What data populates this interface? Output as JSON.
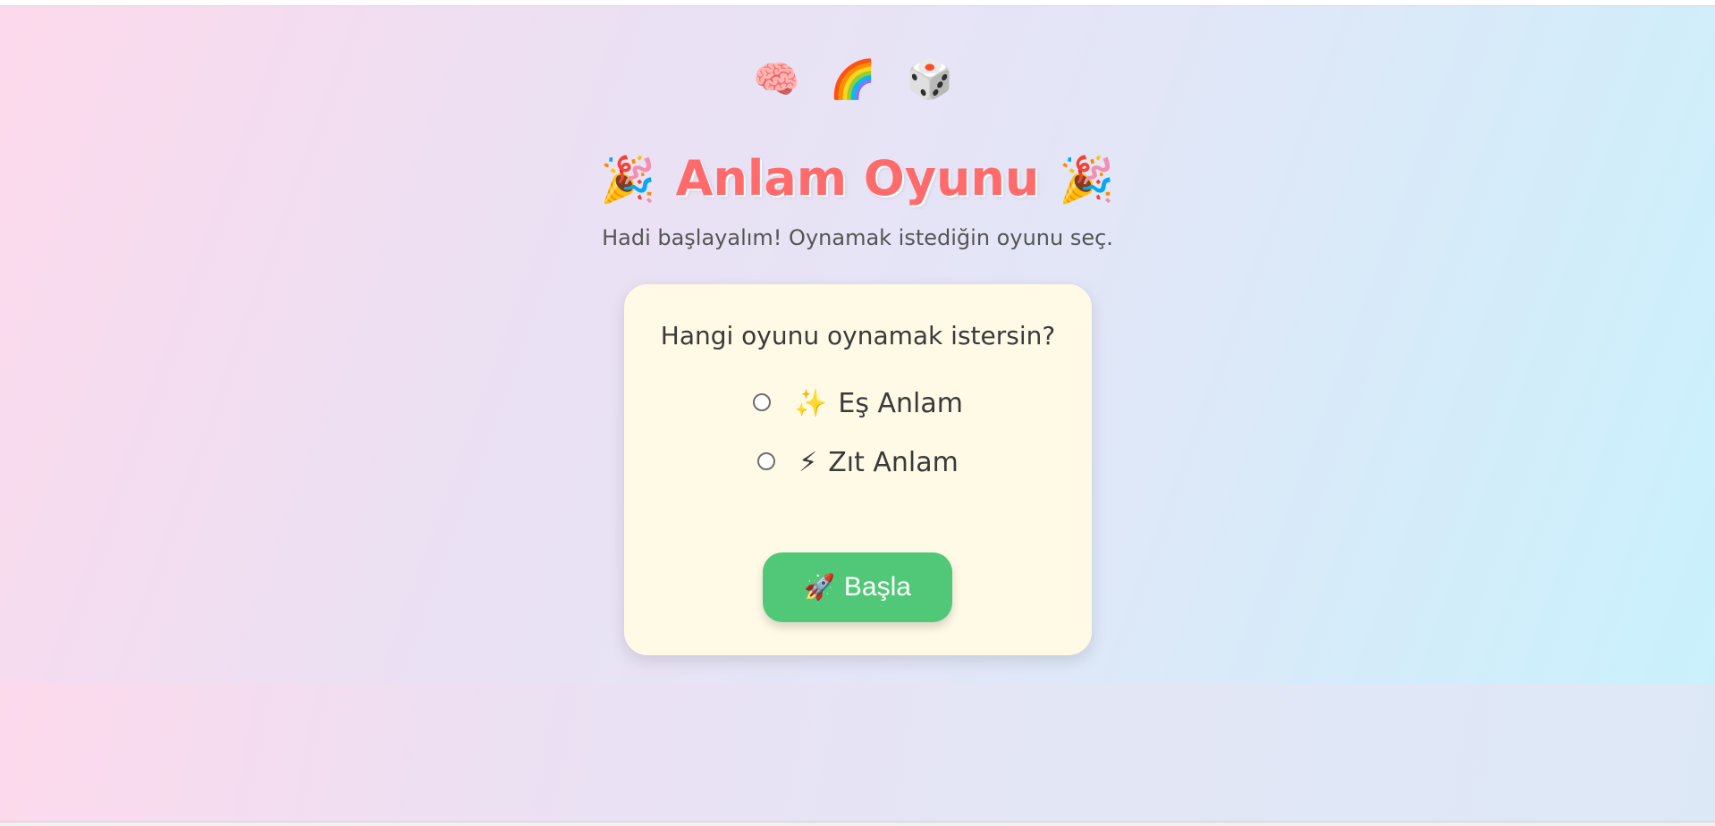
{
  "header": {
    "emoji_icons": [
      {
        "name": "brain-icon",
        "glyph": "🧠"
      },
      {
        "name": "rainbow-icon",
        "glyph": "🌈"
      },
      {
        "name": "dice-icon",
        "glyph": "🎲"
      }
    ],
    "title_left_emoji": "🎉",
    "title": "Anlam Oyunu",
    "title_right_emoji": "🎉",
    "subtitle": "Hadi başlayalım! Oynamak istediğin oyunu seç."
  },
  "card": {
    "question": "Hangi oyunu oynamak istersin?",
    "options": [
      {
        "emoji": "✨",
        "label": "Eş Anlam",
        "selected": false
      },
      {
        "emoji": "⚡",
        "label": "Zıt Anlam",
        "selected": false
      }
    ],
    "start_button": {
      "emoji": "🚀",
      "label": "Başla"
    }
  },
  "colors": {
    "title": "#ff6b6b",
    "card_background": "#fffae6",
    "button": "#51c878",
    "text": "#3a3a3a"
  }
}
